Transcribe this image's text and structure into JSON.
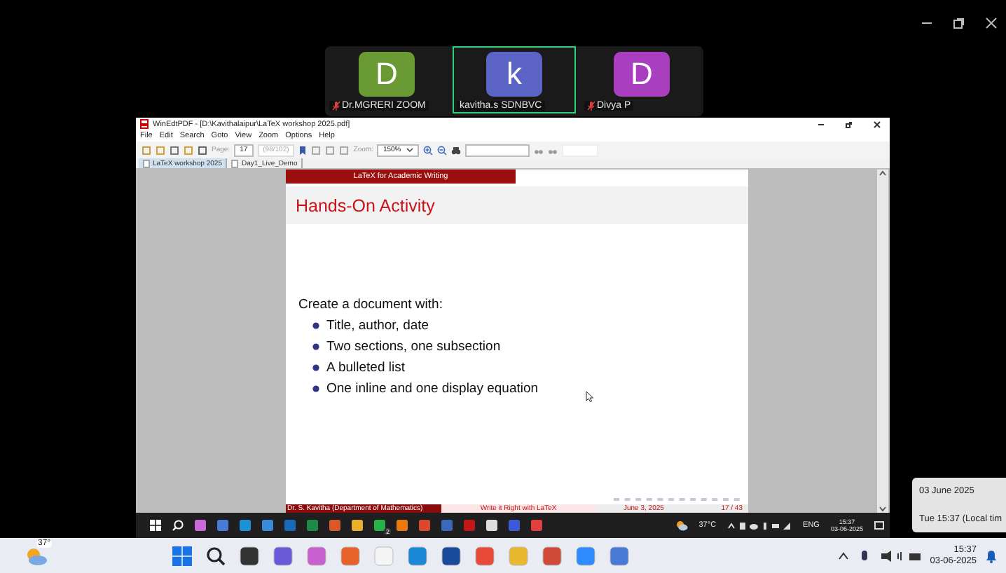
{
  "participants": [
    {
      "letter": "D",
      "name": "Dr.MGRERI ZOOM",
      "color": "#6a9a34",
      "muted": true,
      "active_speaker": false
    },
    {
      "letter": "k",
      "name": "kavitha.s SDNBVC",
      "color": "#5b63c4",
      "muted": false,
      "active_speaker": true
    },
    {
      "letter": "D",
      "name": "Divya P",
      "color": "#a93fbf",
      "muted": true,
      "active_speaker": false
    }
  ],
  "viewer": {
    "title": "WinEdtPDF - [D:\\Kavithalaipur\\LaTeX workshop 2025.pdf]",
    "menu": [
      "File",
      "Edit",
      "Search",
      "Goto",
      "View",
      "Zoom",
      "Options",
      "Help"
    ],
    "toolbar": {
      "page_label": "Page:",
      "page": "17",
      "page_count": "(98/102)",
      "zoom_label": "Zoom:",
      "zoom": "150%"
    },
    "tabs": [
      {
        "label": "LaTeX workshop 2025",
        "selected": true
      },
      {
        "label": "Day1_Live_Demo",
        "selected": false
      }
    ],
    "slide": {
      "header": "LaTeX for Academic Writing",
      "title": "Hands-On Activity",
      "intro": "Create a document with:",
      "bullets": [
        "Title, author, date",
        "Two sections, one subsection",
        "A bulleted list",
        "One inline and one display equation"
      ],
      "footer": {
        "author": "Dr. S. Kavitha (Department of Mathematics)",
        "short_title": "Write it Right with LaTeX",
        "date": "June 3, 2025",
        "page": "17 / 43"
      }
    }
  },
  "inner_taskbar": {
    "badge": "2",
    "weather": "37°C",
    "language": "ENG",
    "time": "15:37",
    "date": "03-06-2025"
  },
  "taskbar": {
    "weather": "37°",
    "time": "15:37",
    "date": "03-06-2025"
  },
  "date_popup": {
    "date": "03 June 2025",
    "time": "Tue 15:37 (Local tim"
  }
}
